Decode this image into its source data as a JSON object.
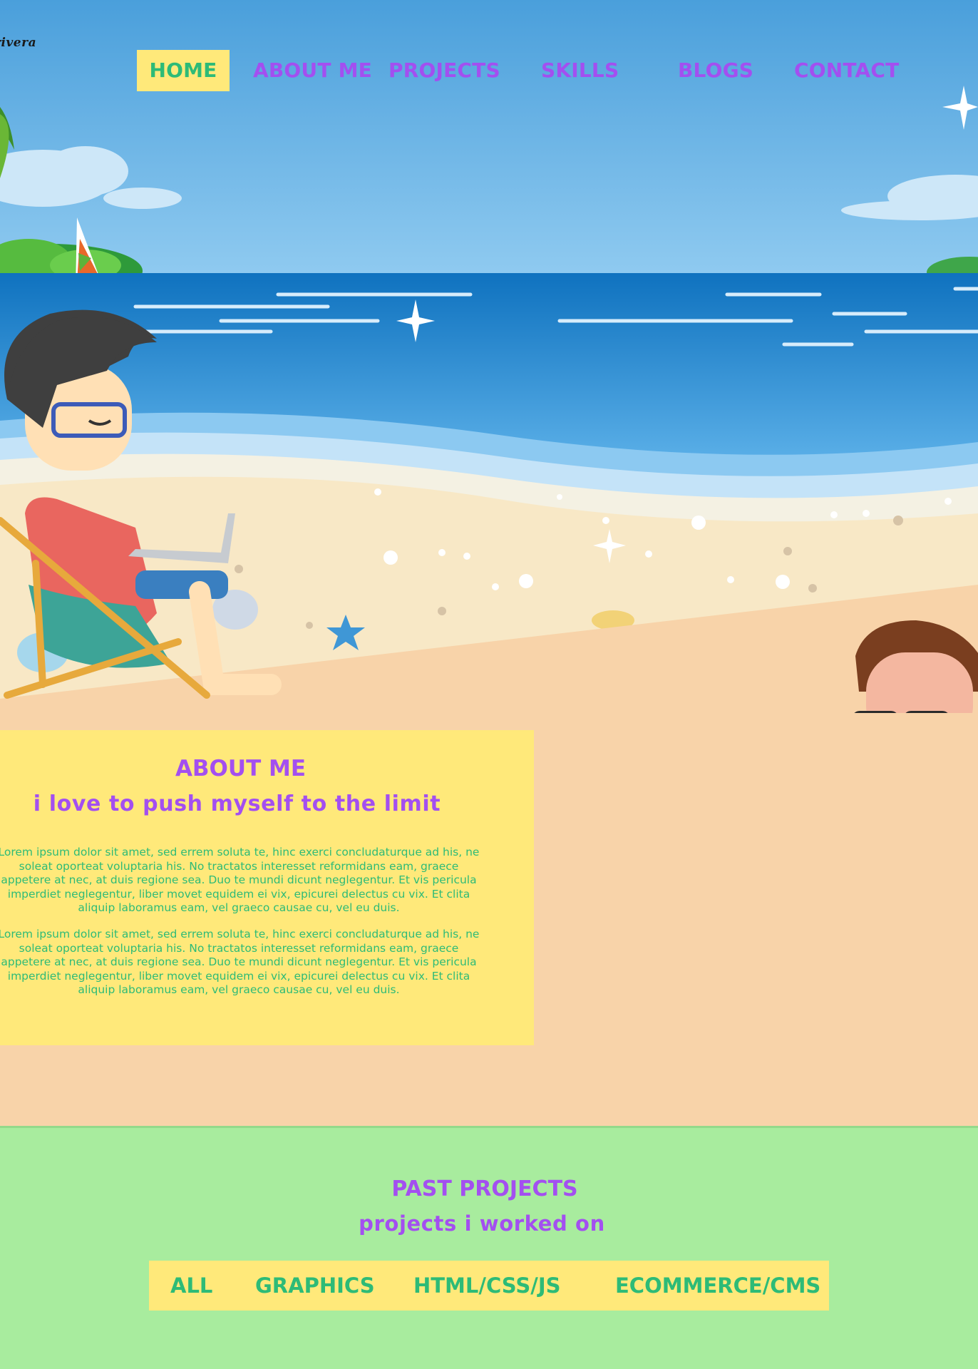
{
  "logo": {
    "text": "rivera"
  },
  "nav": {
    "items": [
      {
        "label": "HOME",
        "active": true
      },
      {
        "label": "ABOUT ME",
        "active": false
      },
      {
        "label": "PROJECTS",
        "active": false
      },
      {
        "label": "SKILLS",
        "active": false
      },
      {
        "label": "BLOGS",
        "active": false
      },
      {
        "label": "CONTACT",
        "active": false
      }
    ]
  },
  "about": {
    "title": "ABOUT ME",
    "subtitle": "i love to push myself to the limit",
    "paragraphs": [
      "Lorem ipsum dolor sit amet, sed errem soluta te, hinc exerci concludaturque ad his, ne soleat oporteat voluptaria his. No tractatos interesset reformidans eam, graece appetere at nec, at duis regione sea. Duo te mundi dicunt neglegentur. Et vis pericula imperdiet neglegentur, liber movet equidem ei vix, epicurei delectus cu vix. Et clita aliquip laboramus eam, vel graeco causae cu, vel eu duis.",
      "Lorem ipsum dolor sit amet, sed errem soluta te, hinc exerci concludaturque ad his, ne soleat oporteat voluptaria his. No tractatos interesset reformidans eam, graece appetere at nec, at duis regione sea. Duo te mundi dicunt neglegentur. Et vis pericula imperdiet neglegentur, liber movet equidem ei vix, epicurei delectus cu vix. Et clita aliquip laboramus eam, vel graeco causae cu, vel eu duis."
    ]
  },
  "projects": {
    "title": "PAST PROJECTS",
    "subtitle": "projects i worked on",
    "filters": [
      "ALL",
      "GRAPHICS",
      "HTML/CSS/JS",
      "ECOMMERCE/CMS"
    ]
  },
  "colors": {
    "accent_purple": "#a34ff0",
    "accent_green": "#2dbb77",
    "highlight_yellow": "#ffe97a",
    "sand": "#f8d3a9",
    "projects_bg": "#a8ec9e",
    "sky": "#5aaee2"
  },
  "icons": [
    "sparkle-icon",
    "starfish-icon",
    "palm-tree-icon"
  ]
}
